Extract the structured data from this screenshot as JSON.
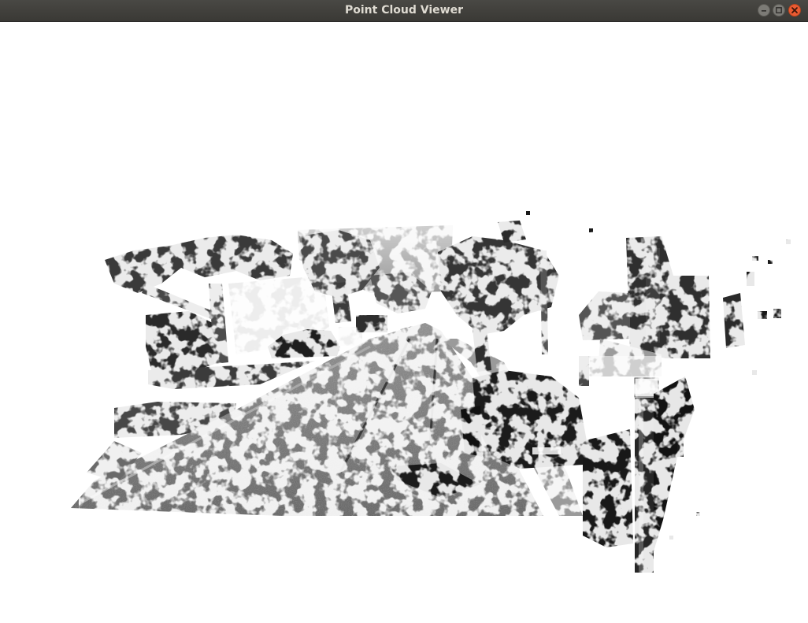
{
  "window": {
    "title": "Point Cloud Viewer",
    "controls": {
      "minimize": "minimize-icon",
      "maximize": "maximize-icon",
      "close": "close-icon"
    }
  },
  "colors": {
    "titlebar": "#3f3e3a",
    "title_text": "#dfdbd2",
    "close_button": "#ea5b32",
    "background": "#ffffff"
  },
  "viewport": {
    "content": "grayscale street-scene point cloud"
  }
}
